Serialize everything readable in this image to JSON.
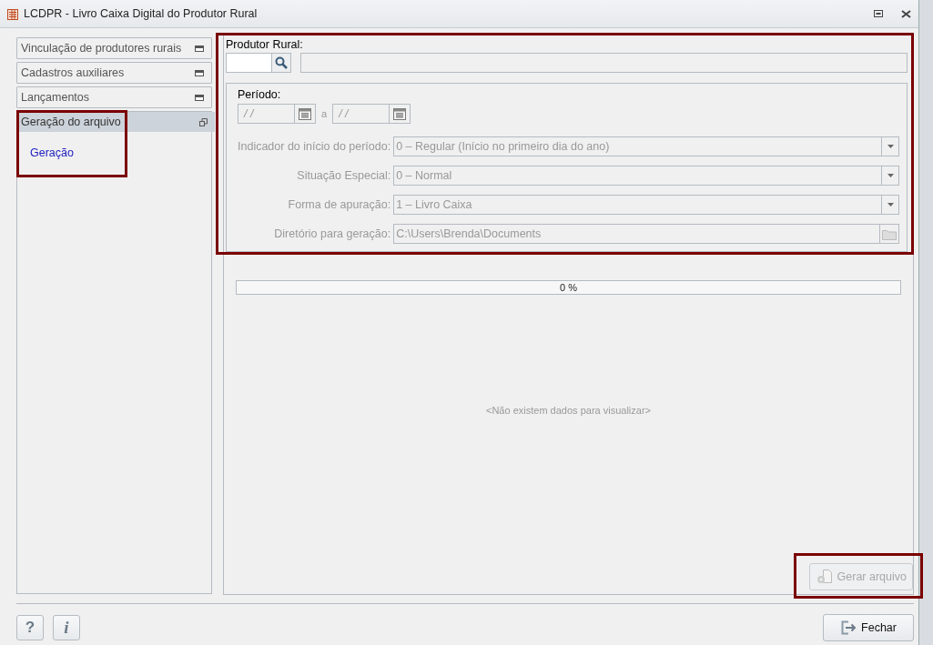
{
  "window": {
    "title": "LCDPR - Livro Caixa Digital do Produtor Rural"
  },
  "sidebar": {
    "groups": [
      {
        "label": "Vinculação de produtores rurais",
        "expanded": false,
        "highlighted": false
      },
      {
        "label": "Cadastros auxiliares",
        "expanded": false,
        "highlighted": false
      },
      {
        "label": "Lançamentos",
        "expanded": false,
        "highlighted": false
      },
      {
        "label": "Geração do arquivo",
        "expanded": true,
        "highlighted": true,
        "children": [
          {
            "label": "Geração"
          }
        ]
      }
    ]
  },
  "form": {
    "highlighted": true,
    "producer": {
      "label": "Produtor Rural:"
    },
    "period": {
      "label": "Período:",
      "disabled": true,
      "start": "/ /",
      "separator": "a",
      "end": "/ /",
      "fields": [
        {
          "kind": "dropdown",
          "label": "Indicador do início do período:",
          "value": "0 – Regular (Início no primeiro dia do ano)"
        },
        {
          "kind": "dropdown",
          "label": "Situação Especial:",
          "value": "0 – Normal"
        },
        {
          "kind": "dropdown",
          "label": "Forma de apuração:",
          "value": "1 – Livro Caixa"
        },
        {
          "kind": "folder",
          "label": "Diretório para geração:",
          "value": "C:\\Users\\Brenda\\Documents"
        }
      ]
    }
  },
  "progress": {
    "level": 0,
    "reading": "0 %"
  },
  "empty_message": "<Não existem dados para visualizar>",
  "generate_button": {
    "label": "Gerar arquivo",
    "disabled": true,
    "highlighted": true
  },
  "footer": {
    "help_button": {
      "label": "?"
    },
    "info_button": {
      "label": "i"
    },
    "close_button": {
      "label": "Fechar"
    }
  }
}
